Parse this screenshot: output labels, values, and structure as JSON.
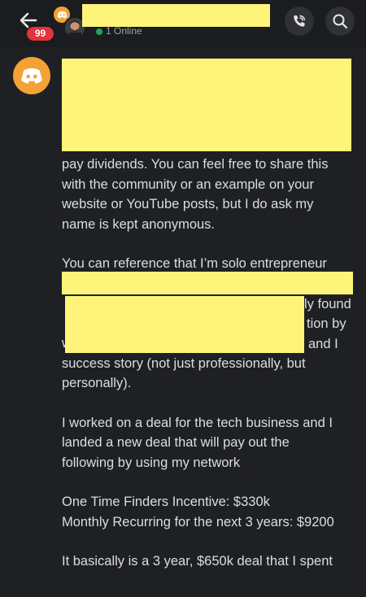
{
  "header": {
    "badge_count": "99",
    "status_text": "1 Online",
    "icons": {
      "back": "arrow-left-icon",
      "call": "phone-call-icon",
      "search": "search-icon"
    },
    "colors": {
      "badge": "#e3333c",
      "online": "#23a55a",
      "avatar_orange": "#f4a235"
    }
  },
  "message": {
    "avatar_icon": "discord-icon",
    "paragraph_1": "pay dividends. You can feel free to share this\nwith the community or an example on your\nwebsite or YouTube posts, but I do ask my\nname is kept anonymous.",
    "paragraph_2_line_1": "You can reference that I’m solo entrepreneur",
    "paragraph_2_frag_1": "ly found",
    "paragraph_2_frag_2": "tion by",
    "paragraph_2_frag_3": "and I",
    "paragraph_2_rest": "want you to be able to reference another\nsuccess story (not just professionally, but\npersonally).",
    "paragraph_3": "I worked on a deal for the tech business and I\nlanded a new deal that will pay out the\nfollowing by using my network",
    "paragraph_4": "One Time Finders Incentive: $330k\nMonthly Recurring for the next 3 years: $9200",
    "paragraph_5": "It basically is a 3 year, $650k deal that I spent"
  }
}
